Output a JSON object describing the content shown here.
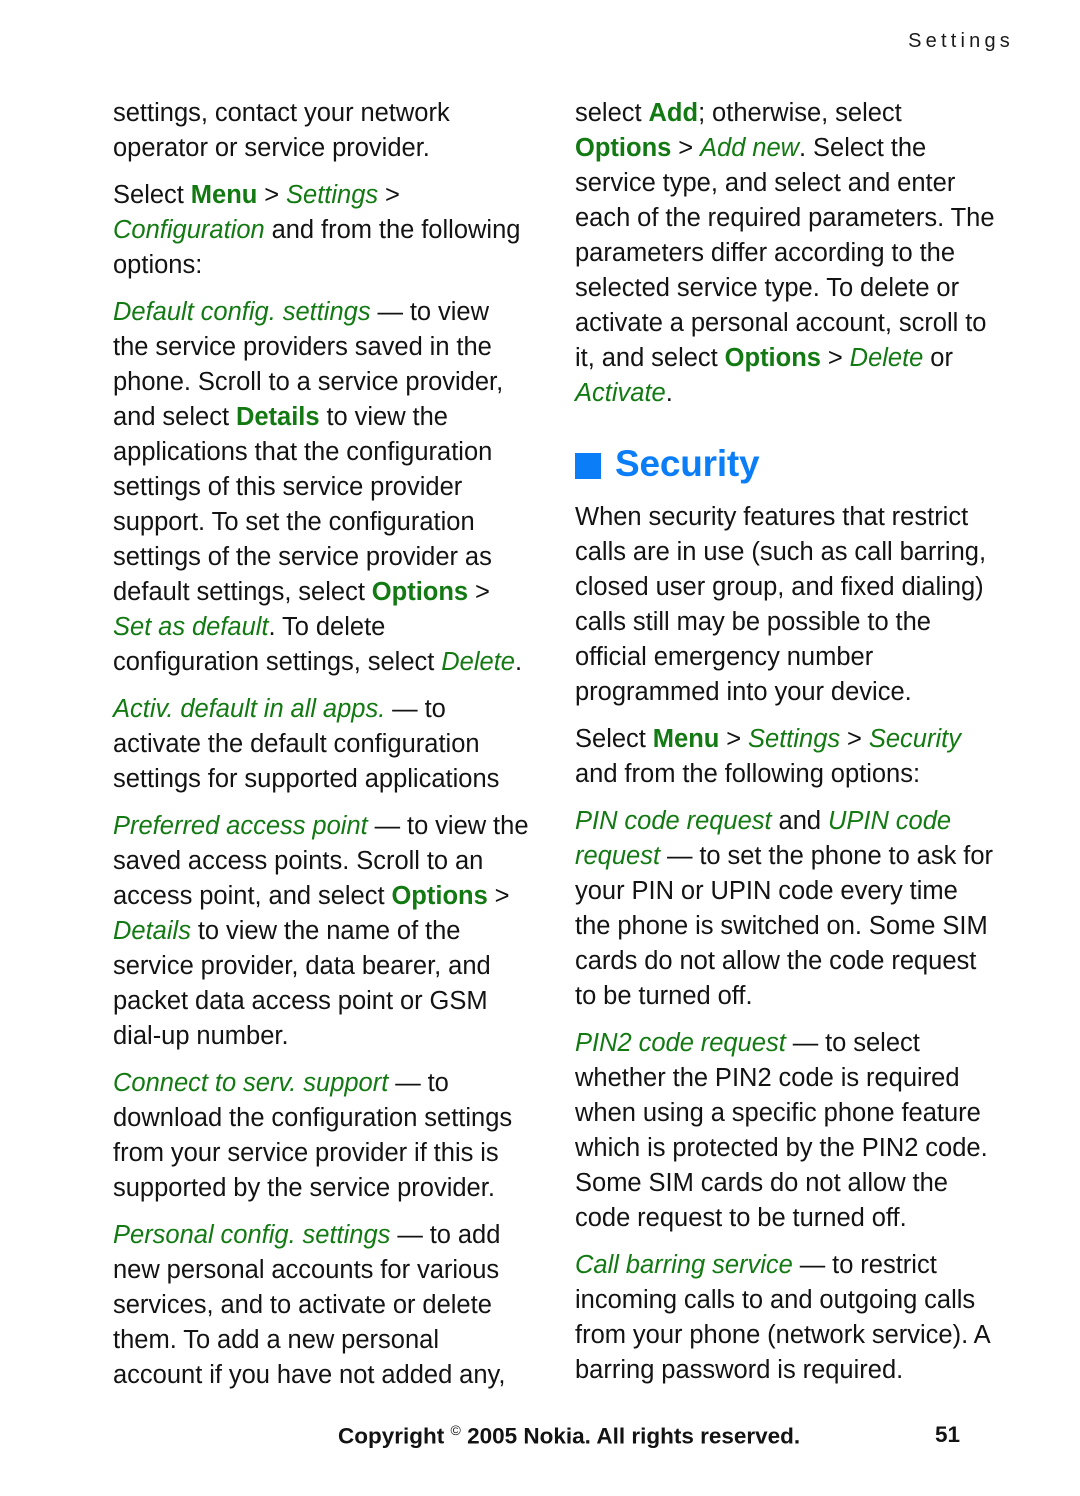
{
  "running_head": "Settings",
  "colors": {
    "green": "#137a13",
    "blue": "#0b7ef7",
    "text": "#131313"
  },
  "left_column": {
    "p1": {
      "t1": "settings, contact your network operator or service provider."
    },
    "p2": {
      "t1": "Select ",
      "menu": "Menu",
      "gt1": " > ",
      "settings": "Settings",
      "gt2": " > ",
      "configuration": "Configuration",
      "t2": " and from the following options:"
    },
    "p3": {
      "term": "Default config. settings",
      "t1": " — to view the service providers saved in the phone. Scroll to a service provider, and select ",
      "details": "Details",
      "t2": " to view the applications that the configuration settings of this service provider support. To set the configuration settings of the service provider as default settings, select ",
      "options": "Options",
      "gt1": " > ",
      "set_as_default": "Set as default",
      "t3": ". To delete configuration settings, select ",
      "delete": "Delete",
      "t4": "."
    },
    "p4": {
      "term": "Activ. default in all apps.",
      "t1": " — to activate the default configuration settings for supported applications"
    },
    "p5": {
      "term": "Preferred access point",
      "t1": " — to view the saved access points. Scroll to an access point, and select ",
      "options": "Options",
      "gt1": " > ",
      "details": "Details",
      "t2": " to view the name of the service provider, data bearer, and packet data access point or GSM dial-up number."
    },
    "p6": {
      "term": "Connect to serv. support",
      "t1": " — to download the configuration settings from your service provider if this is supported by the service provider."
    },
    "p7": {
      "term": "Personal config. settings",
      "t1": " — to add new personal accounts for various services, and to activate or delete them. To add a new personal account if you have not added any,"
    }
  },
  "right_column": {
    "p1": {
      "t1": "select ",
      "add": "Add",
      "t2": "; otherwise, select ",
      "options": "Options",
      "gt1": " > ",
      "add_new": "Add new",
      "t3": ". Select the service type, and select and enter each of the required parameters. The parameters differ according to the selected service type. To delete or activate a personal account, scroll to it, and select ",
      "options2": "Options",
      "gt2": " > ",
      "delete": "Delete",
      "t4": " or ",
      "activate": "Activate",
      "t5": "."
    },
    "heading": "Security",
    "heading_bullet": "square-bullet",
    "p2": {
      "t1": "When security features that restrict calls are in use (such as call barring, closed user group, and fixed dialing) calls still may be possible to the official emergency number programmed into your device."
    },
    "p3": {
      "t1": "Select ",
      "menu": "Menu",
      "gt1": " > ",
      "settings": "Settings",
      "gt2": " > ",
      "security": "Security",
      "t2": " and from the following options:"
    },
    "p4": {
      "term1": "PIN code request",
      "and": " and ",
      "term2": "UPIN code request",
      "t1": " — to set the phone to ask for your PIN or UPIN code every time the phone is switched on. Some SIM cards do not allow the code request to be turned off."
    },
    "p5": {
      "term": "PIN2 code request",
      "t1": " — to select whether the PIN2 code is required when using a specific phone feature which is protected by the PIN2 code. Some SIM cards do not allow the code request to be turned off."
    },
    "p6": {
      "term": "Call barring service",
      "t1": " — to restrict incoming calls to and outgoing calls from your phone (network service). A barring password is required."
    }
  },
  "footer": {
    "copyright_prefix": "Copyright ",
    "copyright_symbol": "©",
    "copyright_rest": " 2005 Nokia. All rights reserved.",
    "page_number": "51"
  }
}
